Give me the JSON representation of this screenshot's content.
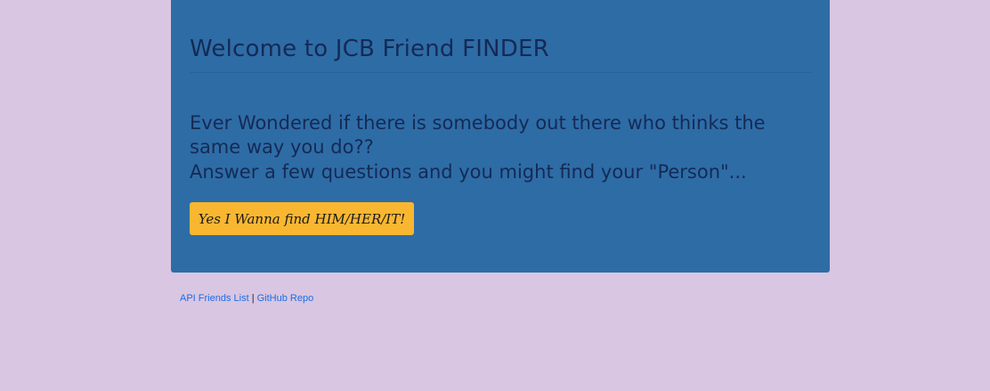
{
  "main": {
    "title": "Welcome to JCB Friend FINDER",
    "lead_line1": "Ever Wondered if there is somebody out there who thinks the same way you do??",
    "lead_line2": "Answer a few questions and you might find your \"Person\"...",
    "cta_label": "Yes I Wanna find HIM/HER/IT!"
  },
  "footer": {
    "api_link_label": "API Friends List",
    "separator": "|",
    "github_link_label": "GitHub Repo"
  },
  "colors": {
    "background": "#d9c6e2",
    "jumbotron": "#2e6ca6",
    "heading_text": "#142a55",
    "cta_button": "#f9b731",
    "link": "#1a6ee6"
  }
}
